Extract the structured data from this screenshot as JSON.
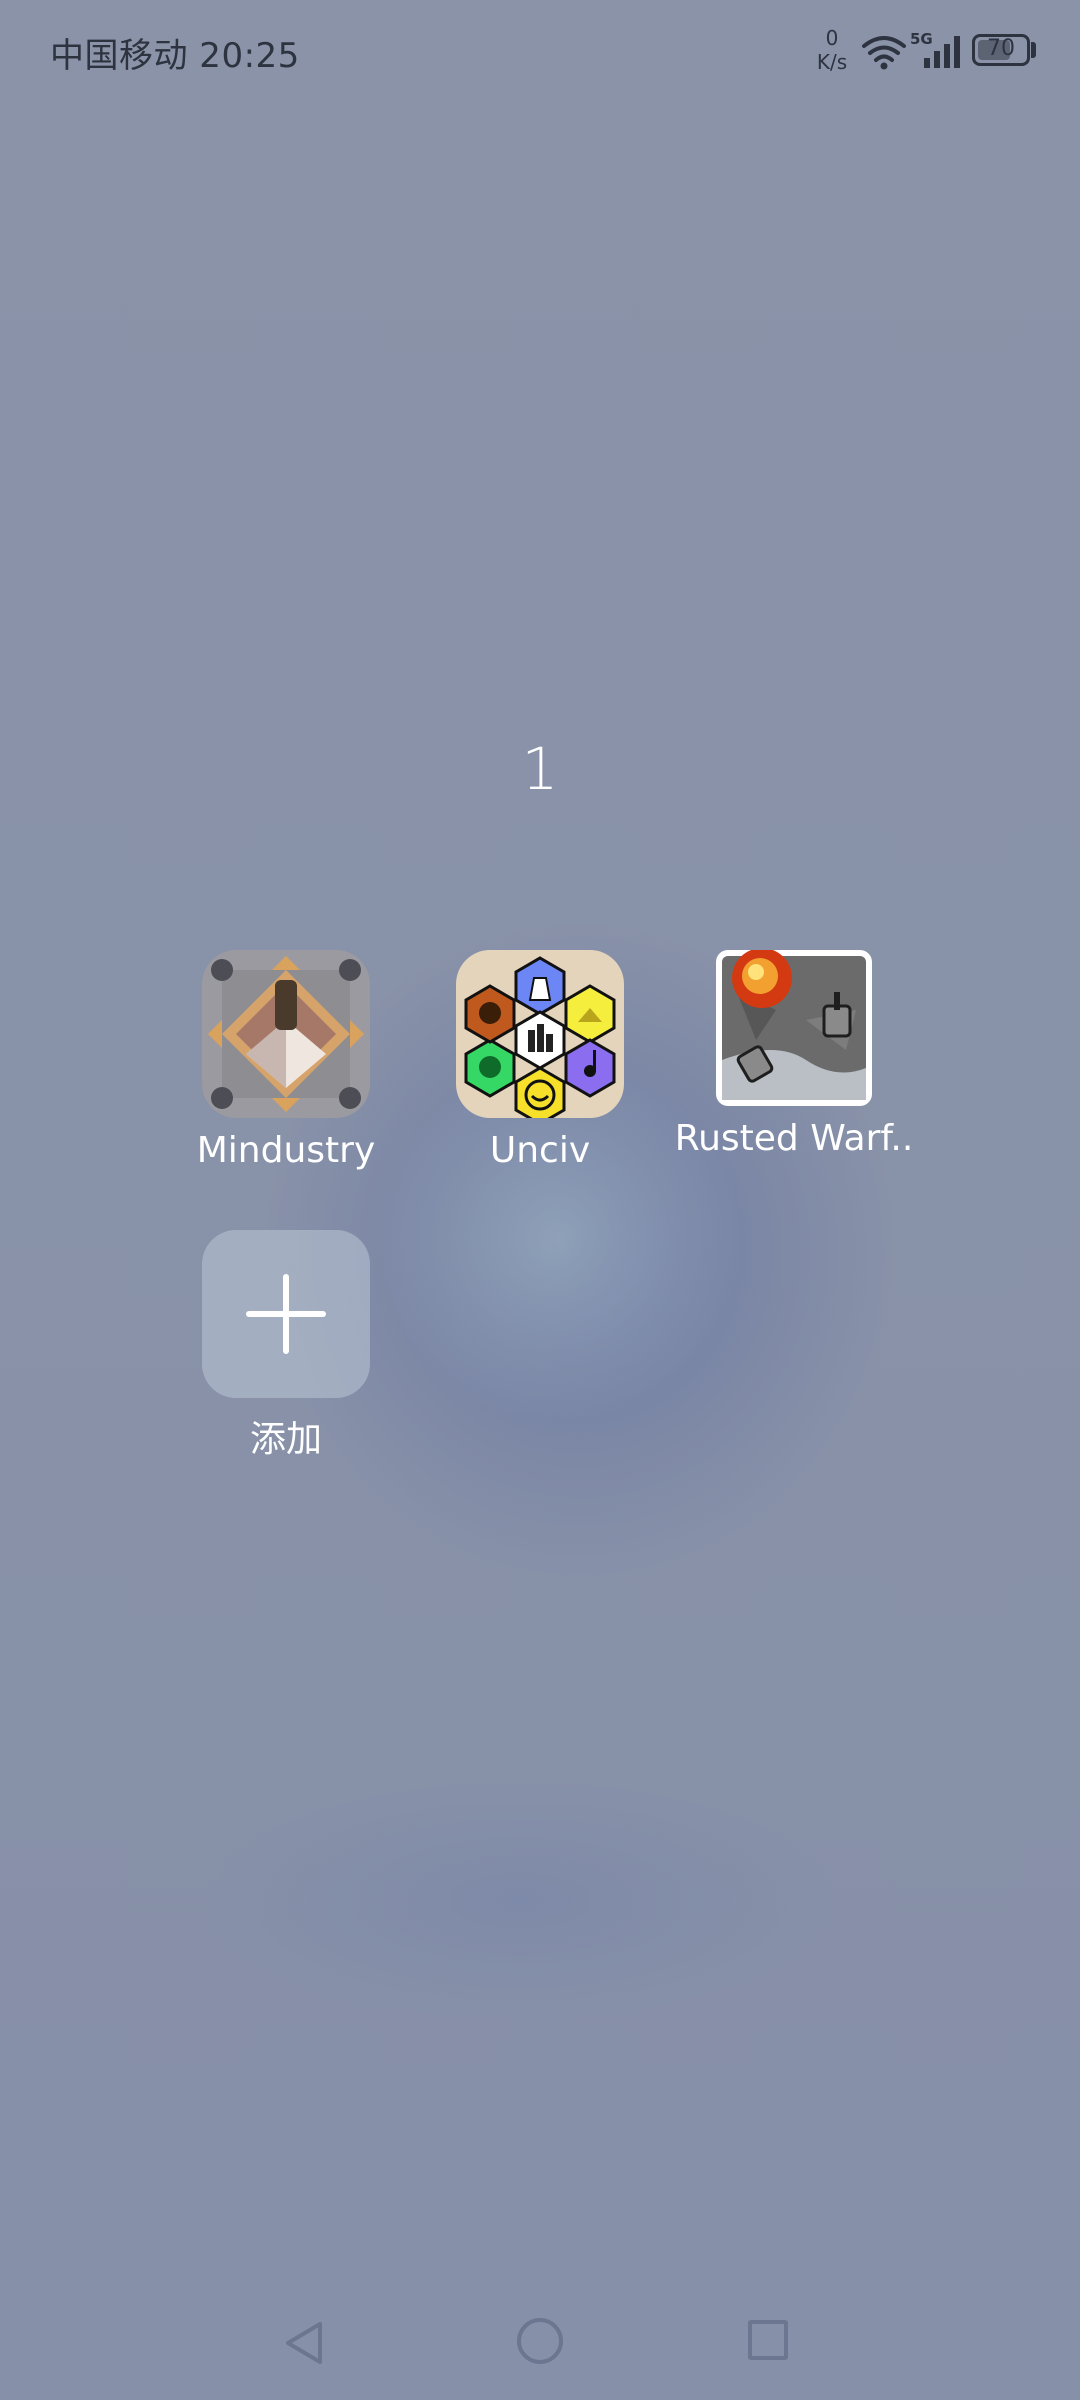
{
  "status_bar": {
    "carrier_time": "中国移动 20:25",
    "net_speed_value": "0",
    "net_speed_unit": "K/s",
    "network_type": "5G",
    "battery": "70",
    "battery_level": 0.7
  },
  "folder": {
    "title": "1",
    "apps": [
      {
        "label": "Mindustry",
        "icon": "mindustry-icon"
      },
      {
        "label": "Unciv",
        "icon": "unciv-icon"
      },
      {
        "label": "Rusted Warf..",
        "icon": "rusted-warfare-icon"
      }
    ],
    "add_label": "添加"
  },
  "nav": {
    "back": "back-icon",
    "home": "home-icon",
    "recents": "recents-icon"
  }
}
